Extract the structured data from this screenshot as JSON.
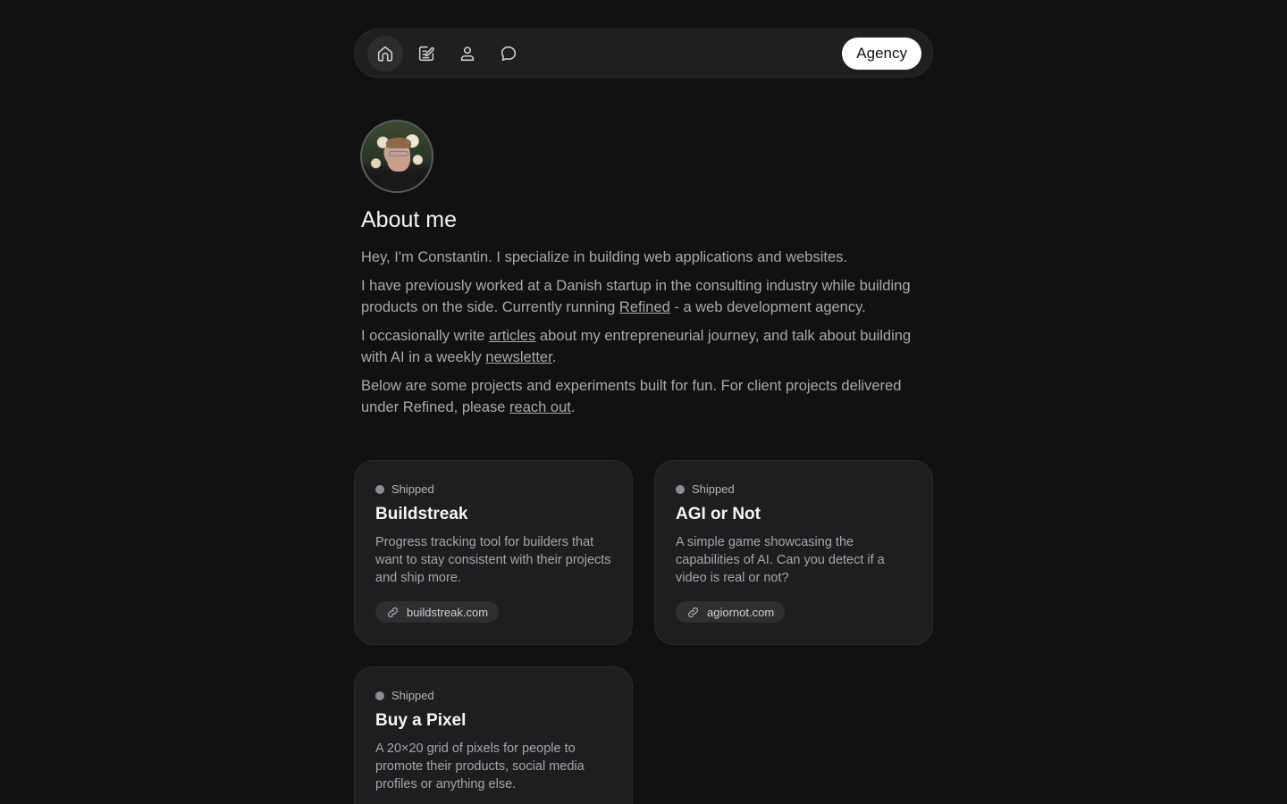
{
  "nav": {
    "items": [
      {
        "icon": "home-icon",
        "active": true
      },
      {
        "icon": "edit-icon",
        "active": false
      },
      {
        "icon": "user-icon",
        "active": false
      },
      {
        "icon": "chat-icon",
        "active": false
      }
    ],
    "agency_label": "Agency"
  },
  "about": {
    "title": "About me",
    "p1": "Hey, I'm Constantin. I specialize in building web applications and websites.",
    "p2_before": "I have previously worked at a Danish startup in the consulting industry while building products on the side. Currently running ",
    "p2_link": "Refined",
    "p2_after": " - a web development agency.",
    "p3_before": "I occasionally write ",
    "p3_link1": "articles",
    "p3_middle": " about my entrepreneurial journey, and talk about building with AI in a weekly ",
    "p3_link2": "newsletter",
    "p3_after": ".",
    "p4_before": "Below are some projects and experiments built for fun. For client projects delivered under Refined, please ",
    "p4_link": "reach out",
    "p4_after": "."
  },
  "projects": [
    {
      "status": "Shipped",
      "title": "Buildstreak",
      "description": "Progress tracking tool for builders that want to stay consistent with their projects and ship more.",
      "link": "buildstreak.com"
    },
    {
      "status": "Shipped",
      "title": "AGI or Not",
      "description": "A simple game showcasing the capabilities of AI. Can you detect if a video is real or not?",
      "link": "agiornot.com"
    },
    {
      "status": "Shipped",
      "title": "Buy a Pixel",
      "description": "A 20×20 grid of pixels for people to promote their products, social media profiles or anything else."
    }
  ],
  "colors": {
    "background": "#111111",
    "card": "#1e1e20",
    "text_muted": "#a9a9ad",
    "status_dot": "#8e8e92"
  }
}
